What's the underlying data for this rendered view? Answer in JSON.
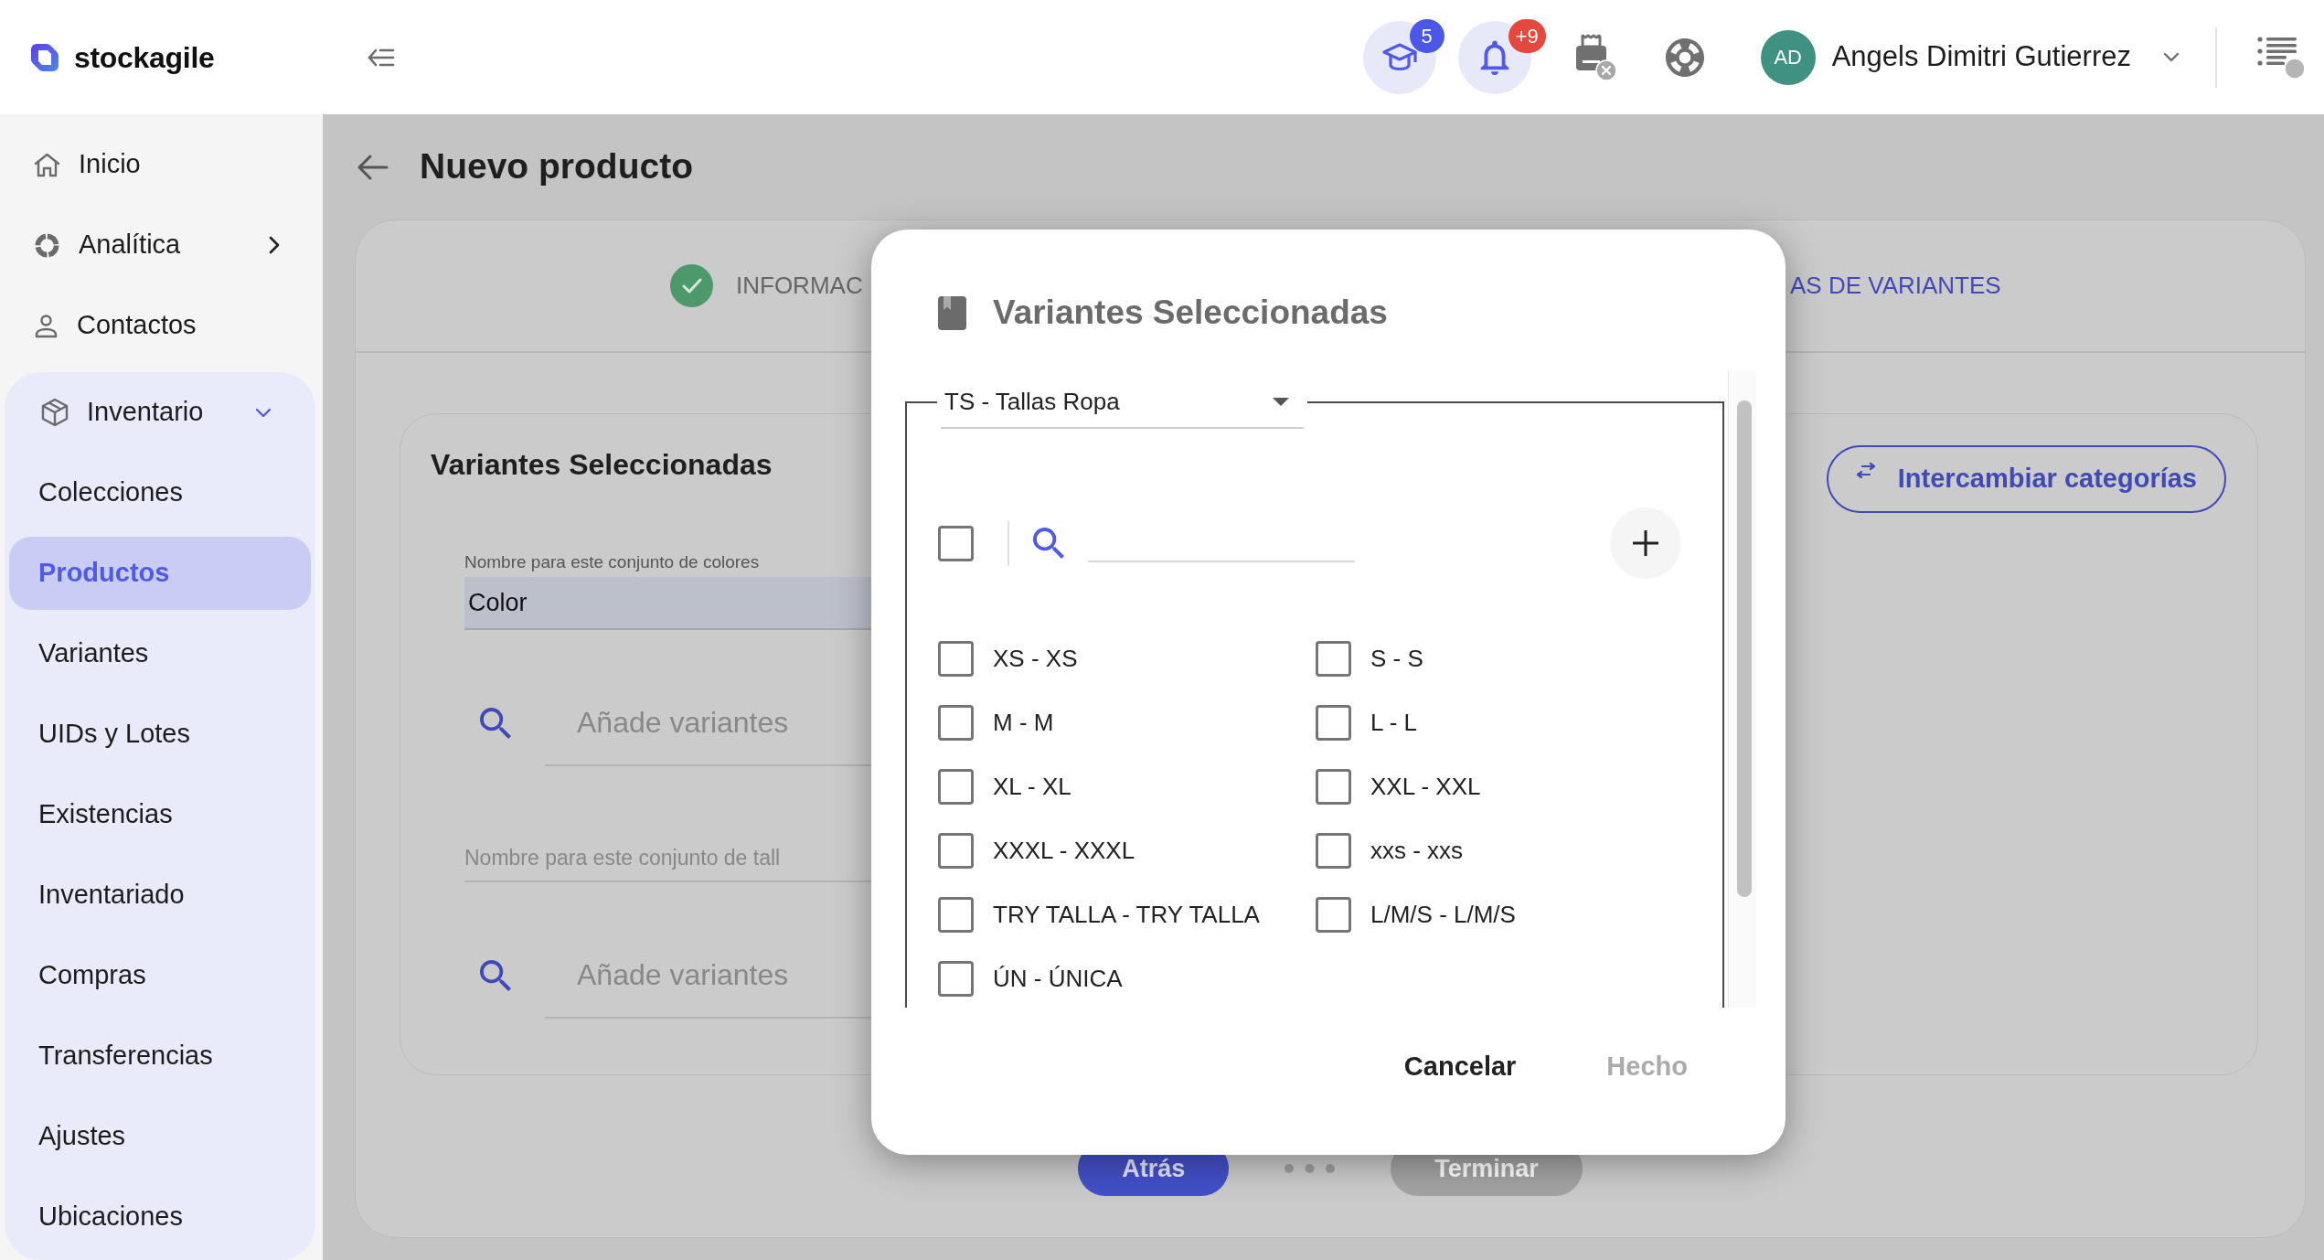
{
  "topbar": {
    "logo": "stockagile",
    "notifications": [
      {
        "badge": "5",
        "color": "#4b57e6"
      },
      {
        "badge": "+9",
        "color": "#e4483e"
      }
    ],
    "printer": {
      "connected": false
    },
    "user": {
      "initials": "AD",
      "name": "Angels Dimitri Gutierrez"
    }
  },
  "sidebar": {
    "items": [
      {
        "label": "Inicio",
        "selected": false
      },
      {
        "label": "Analítica",
        "selected": false,
        "expanded": false
      },
      {
        "label": "Contactos",
        "selected": false
      },
      {
        "label": "Inventario",
        "selected": false,
        "expanded": true,
        "children": [
          {
            "label": "Colecciones",
            "selected": false
          },
          {
            "label": "Productos",
            "selected": true
          },
          {
            "label": "Variantes",
            "selected": false
          },
          {
            "label": "UIDs y Lotes",
            "selected": false
          },
          {
            "label": "Existencias",
            "selected": false
          },
          {
            "label": "Inventariado",
            "selected": false
          },
          {
            "label": "Compras",
            "selected": false
          },
          {
            "label": "Transferencias",
            "selected": false
          },
          {
            "label": "Ajustes",
            "selected": false
          },
          {
            "label": "Ubicaciones",
            "selected": false
          }
        ]
      }
    ]
  },
  "page": {
    "title": "Nuevo producto",
    "steps": [
      {
        "label": "INFORMAC",
        "completed": true,
        "selected": false
      },
      {
        "label": "AS DE VARIANTES",
        "completed": false,
        "selected": true
      }
    ],
    "variants": {
      "title": "Variantes Seleccionadas",
      "swap_button": "Intercambiar categorías",
      "color_set": {
        "label": "Nombre para este conjunto de colores",
        "value": "Color"
      },
      "color_search": {
        "placeholder": "Añade variantes"
      },
      "size_set": {
        "placeholder": "Nombre para este conjunto de tall"
      },
      "size_search": {
        "placeholder": "Añade variantes"
      }
    },
    "buttons": [
      {
        "label": "Atrás",
        "disabled": false
      },
      {
        "label": "Terminar",
        "disabled": true
      }
    ]
  },
  "modal": {
    "title": "Variantes Seleccionadas",
    "category": {
      "value": "TS - Tallas Ropa"
    },
    "select_all": {
      "checked": false
    },
    "options": [
      {
        "label": "XS - XS",
        "checked": false
      },
      {
        "label": "S - S",
        "checked": false
      },
      {
        "label": "M - M",
        "checked": false
      },
      {
        "label": "L - L",
        "checked": false
      },
      {
        "label": "XL - XL",
        "checked": false
      },
      {
        "label": "XXL - XXL",
        "checked": false
      },
      {
        "label": "XXXL - XXXL",
        "checked": false
      },
      {
        "label": "xxs - xxs",
        "checked": false
      },
      {
        "label": "TRY TALLA - TRY TALLA",
        "checked": false
      },
      {
        "label": "L/M/S - L/M/S",
        "checked": false
      },
      {
        "label": "ÚN - ÚNICA",
        "checked": false
      }
    ],
    "buttons": [
      {
        "label": "Cancelar",
        "disabled": false
      },
      {
        "label": "Hecho",
        "disabled": true
      }
    ]
  }
}
